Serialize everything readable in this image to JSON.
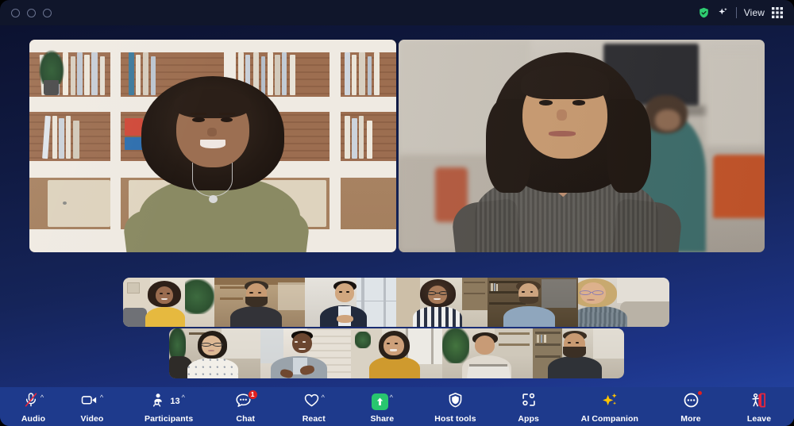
{
  "window": {
    "traffic_lights": [
      "close",
      "minimize",
      "maximize"
    ],
    "right_controls": {
      "encryption_icon": "shield-check-icon",
      "encryption_color": "#2ecc71",
      "ai_icon": "sparkle-icon",
      "view_label": "View",
      "view_icon": "grid-icon"
    }
  },
  "theme": {
    "stage_gradient_top": "#0c1230",
    "stage_gradient_bottom": "#2548a8",
    "toolbar_bg": "#1e3a8c",
    "titlebar_bg": "#10162b",
    "badge_red": "#e02020",
    "share_green": "#28c76f",
    "ai_gold": "#ffc400",
    "leave_red": "#e8253c"
  },
  "main_speakers": [
    {
      "id": "speaker-1",
      "description": "woman with curly hair in olive t-shirt in front of white bookshelf"
    },
    {
      "id": "speaker-2",
      "description": "woman with dark bob haircut in grey knit top in open office"
    }
  ],
  "filmstrip": {
    "row1": [
      {
        "id": "thumb-1",
        "description": "woman with afro in yellow sweater"
      },
      {
        "id": "thumb-2",
        "description": "bearded man in dark tee in loft kitchen"
      },
      {
        "id": "thumb-3",
        "description": "man in navy blazer by window"
      },
      {
        "id": "thumb-4",
        "description": "woman with glasses in striped top"
      },
      {
        "id": "thumb-5",
        "description": "man in blue shirt by bookcase"
      },
      {
        "id": "thumb-6",
        "description": "older woman with glasses in grey shirt"
      }
    ],
    "row2": [
      {
        "id": "thumb-7",
        "description": "woman with glasses in white polka dot blouse"
      },
      {
        "id": "thumb-8",
        "description": "man in grey shirt gesturing, brick wall"
      },
      {
        "id": "thumb-9",
        "description": "woman in mustard top at window"
      },
      {
        "id": "thumb-10",
        "description": "person at laptop with plants"
      },
      {
        "id": "thumb-11",
        "description": "bearded man in dark tee at bookshelf"
      }
    ]
  },
  "toolbar": {
    "left": [
      {
        "id": "audio",
        "label": "Audio",
        "icon": "microphone-muted-icon",
        "caret": "^",
        "muted": true
      },
      {
        "id": "video",
        "label": "Video",
        "icon": "video-camera-icon",
        "caret": "^"
      }
    ],
    "center": [
      {
        "id": "participants",
        "label": "Participants",
        "icon": "people-icon",
        "caret": "^",
        "count": "13"
      },
      {
        "id": "chat",
        "label": "Chat",
        "icon": "chat-bubble-icon",
        "caret": "^",
        "badge": "1"
      },
      {
        "id": "react",
        "label": "React",
        "icon": "heart-icon",
        "caret": "^"
      },
      {
        "id": "share",
        "label": "Share",
        "icon": "share-screen-icon",
        "caret": "^"
      },
      {
        "id": "host-tools",
        "label": "Host tools",
        "icon": "shield-icon"
      },
      {
        "id": "apps",
        "label": "Apps",
        "icon": "apps-icon"
      },
      {
        "id": "ai-companion",
        "label": "AI Companion",
        "icon": "sparkle-icon"
      },
      {
        "id": "more",
        "label": "More",
        "icon": "more-circle-icon",
        "dot_badge": true
      }
    ],
    "right": [
      {
        "id": "leave",
        "label": "Leave",
        "icon": "leave-door-icon"
      }
    ]
  }
}
